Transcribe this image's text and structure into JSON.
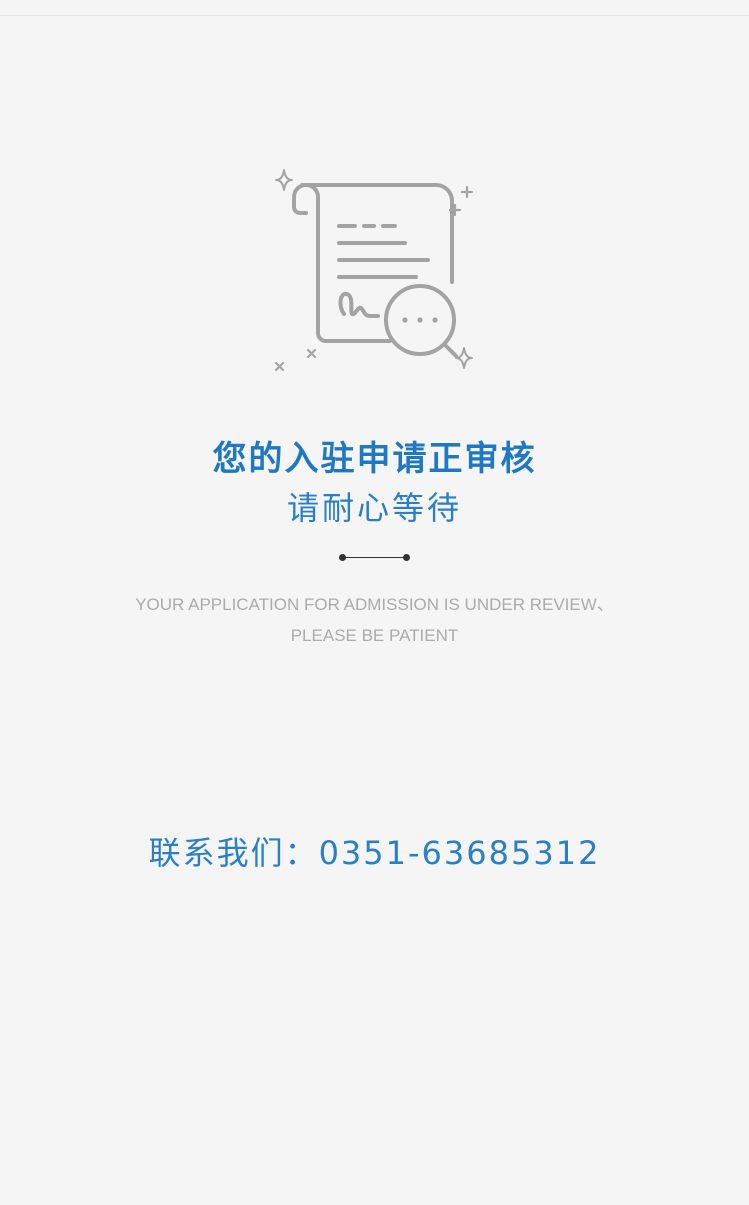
{
  "status": {
    "illustration_icon": "document-review-icon",
    "title": "您的入驻申请正审核",
    "subtitle": "请耐心等待",
    "english_line_1": "YOUR APPLICATION FOR ADMISSION IS UNDER REVIEW、",
    "english_line_2": "PLEASE BE PATIENT"
  },
  "contact": {
    "text": "联系我们：0351-63685312"
  },
  "colors": {
    "background": "#f5f5f5",
    "accent": "#1f78c4",
    "icon_gray": "#a3a3a3",
    "english_text": "#ababab"
  }
}
